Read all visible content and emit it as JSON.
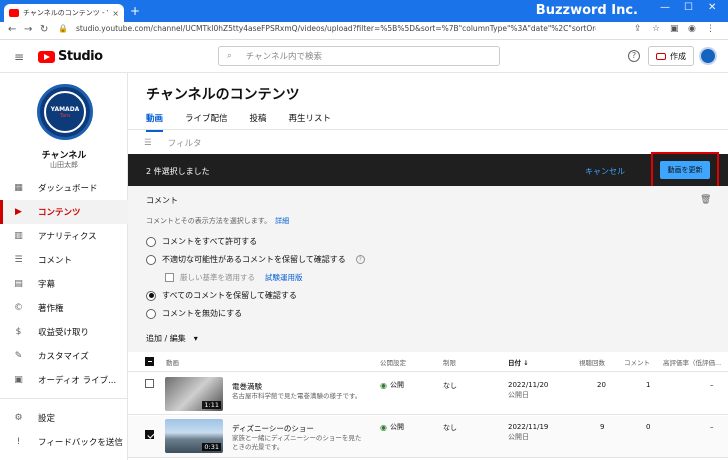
{
  "browser": {
    "tab_title": "チャンネルのコンテンツ - YouTube Stu",
    "tab_close": "×",
    "new_tab": "+",
    "brand": "Buzzword Inc.",
    "win_min": "—",
    "win_max": "☐",
    "win_close": "✕",
    "url": "studio.youtube.com/channel/UCMTkl0hZ5tty4aseFPSRxmQ/videos/upload?filter=%5B%5D&sort=%7B\"columnType\"%3A\"date\"%2C\"sortOrder\"%3A\"DESCENDING\"%7D"
  },
  "header": {
    "logo_text": "Studio",
    "search_placeholder": "チャンネル内で検索",
    "create_label": "作成",
    "help_label": "?"
  },
  "sidebar": {
    "avatar_line1": "YAMADA",
    "avatar_line2": "Taro",
    "channel_title": "チャンネル",
    "channel_name": "山田太郎",
    "items": [
      {
        "label": "ダッシュボード",
        "icon": "dashboard-icon",
        "glyph": "▦"
      },
      {
        "label": "コンテンツ",
        "icon": "content-icon",
        "glyph": "▶"
      },
      {
        "label": "アナリティクス",
        "icon": "analytics-icon",
        "glyph": "▥"
      },
      {
        "label": "コメント",
        "icon": "comments-icon",
        "glyph": "☰"
      },
      {
        "label": "字幕",
        "icon": "subtitles-icon",
        "glyph": "▤"
      },
      {
        "label": "著作権",
        "icon": "copyright-icon",
        "glyph": "©"
      },
      {
        "label": "収益受け取り",
        "icon": "monetization-icon",
        "glyph": "$"
      },
      {
        "label": "カスタマイズ",
        "icon": "customization-icon",
        "glyph": "✎"
      },
      {
        "label": "オーディオ ライブ...",
        "icon": "audio-library-icon",
        "glyph": "▣"
      },
      {
        "label": "設定",
        "icon": "settings-icon",
        "glyph": "⚙"
      },
      {
        "label": "フィードバックを送信",
        "icon": "feedback-icon",
        "glyph": "!"
      }
    ]
  },
  "main": {
    "title": "チャンネルのコンテンツ",
    "tabs": [
      "動画",
      "ライブ配信",
      "投稿",
      "再生リスト"
    ],
    "filter_label": "フィルタ",
    "selection_text": "2 件選択しました",
    "cancel_label": "キャンセル",
    "update_label": "動画を更新",
    "comments_section": {
      "title": "コメント",
      "description": "コメントとその表示方法を選択します。",
      "details_link": "詳細",
      "options": [
        "コメントをすべて許可する",
        "不適切な可能性があるコメントを保留して確認する",
        "すべてのコメントを保留して確認する",
        "コメントを無効にする"
      ],
      "strict_label": "厳しい基準を適用する",
      "beta_link": "試験運用版"
    },
    "add_edit_label": "追加 / 編集",
    "table": {
      "headers": {
        "video": "動画",
        "visibility": "公開設定",
        "restrictions": "制限",
        "date": "日付 ↓",
        "views": "視聴回数",
        "comments": "コメント",
        "likes": "高評価率（低評価..."
      },
      "rows": [
        {
          "title": "電巻満験",
          "desc": "名古屋市科学館で見た電巻満験の様子です。",
          "duration": "1:11",
          "visibility": "公開",
          "restriction": "なし",
          "date": "2022/11/20",
          "date_sub": "公開日",
          "views": "20",
          "comments": "1",
          "likes": "–"
        },
        {
          "title": "ディズニーシーのショー",
          "desc": "家族と一緒にディズニーシーのショーを見たときの光景です。",
          "duration": "0:31",
          "visibility": "公開",
          "restriction": "なし",
          "date": "2022/11/19",
          "date_sub": "公開日",
          "views": "9",
          "comments": "0",
          "likes": "–"
        }
      ]
    }
  },
  "colors": {
    "accent": "#065fd4",
    "brand_red": "#ff0000",
    "selection_bar": "#1f1f1f",
    "update_button": "#3ea6ff",
    "highlight_box": "#e00000"
  }
}
